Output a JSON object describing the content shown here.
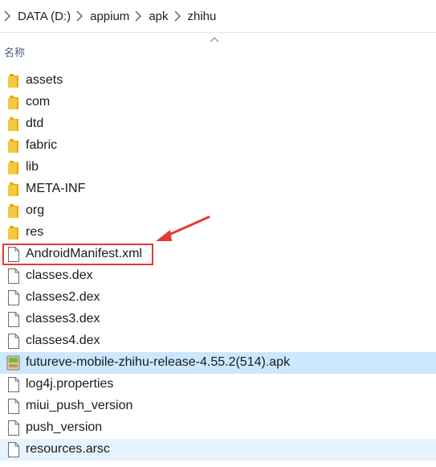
{
  "breadcrumb": [
    "DATA (D:)",
    "appium",
    "apk",
    "zhihu"
  ],
  "header": {
    "name_column": "名称"
  },
  "files": [
    {
      "name": "assets",
      "icon": "folder-icon"
    },
    {
      "name": "com",
      "icon": "folder-icon"
    },
    {
      "name": "dtd",
      "icon": "folder-icon"
    },
    {
      "name": "fabric",
      "icon": "folder-icon"
    },
    {
      "name": "lib",
      "icon": "folder-icon"
    },
    {
      "name": "META-INF",
      "icon": "folder-icon"
    },
    {
      "name": "org",
      "icon": "folder-icon"
    },
    {
      "name": "res",
      "icon": "folder-icon"
    },
    {
      "name": "AndroidManifest.xml",
      "icon": "file-icon"
    },
    {
      "name": "classes.dex",
      "icon": "file-icon"
    },
    {
      "name": "classes2.dex",
      "icon": "file-icon"
    },
    {
      "name": "classes3.dex",
      "icon": "file-icon"
    },
    {
      "name": "classes4.dex",
      "icon": "file-icon"
    },
    {
      "name": "futureve-mobile-zhihu-release-4.55.2(514).apk",
      "icon": "apk-icon"
    },
    {
      "name": "log4j.properties",
      "icon": "file-icon"
    },
    {
      "name": "miui_push_version",
      "icon": "file-icon"
    },
    {
      "name": "push_version",
      "icon": "file-icon"
    },
    {
      "name": "resources.arsc",
      "icon": "file-icon"
    }
  ],
  "colors": {
    "folder": "#f5c842",
    "selected_row": "#cce8ff",
    "hover_row": "#e5f3ff",
    "annotation": "#e53935"
  }
}
